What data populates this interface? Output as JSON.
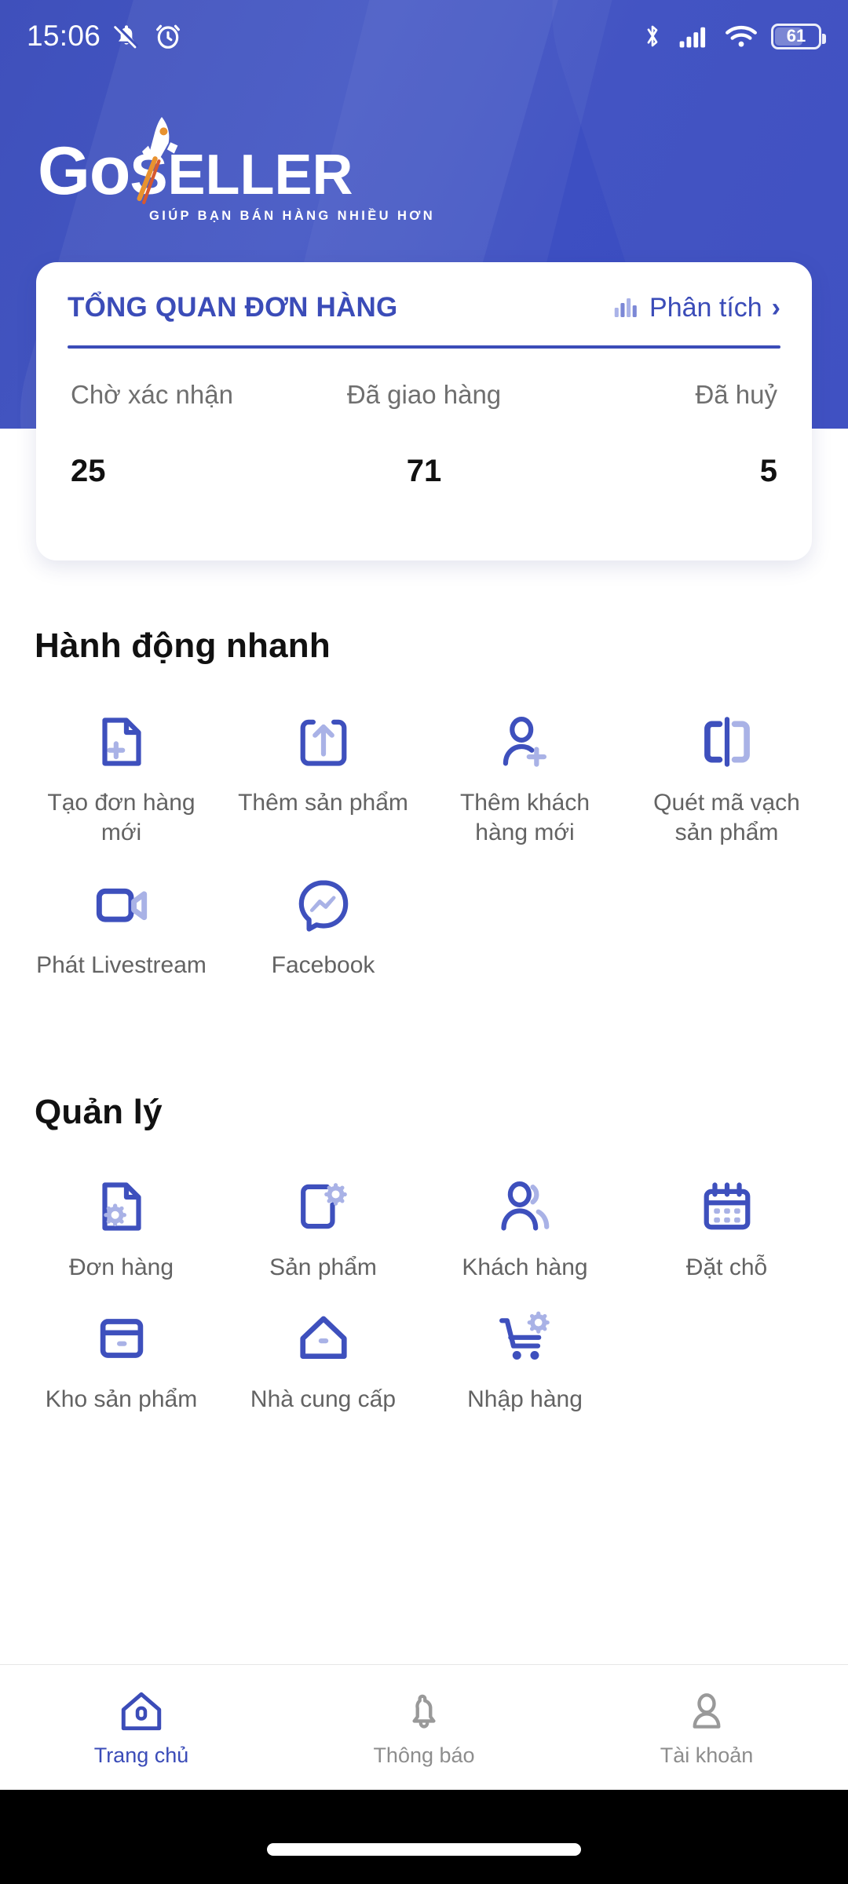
{
  "status_bar": {
    "time": "15:06",
    "icons_left": [
      "bell-muted-icon",
      "alarm-clock-icon"
    ],
    "icons_right": [
      "bluetooth-icon",
      "cellular-signal-icon",
      "wifi-icon"
    ],
    "battery_percent": "61"
  },
  "brand": {
    "logo_go": "Go",
    "logo_seller": "SELLER",
    "tagline": "GIÚP BẠN BÁN HÀNG NHIỀU HƠN",
    "rocket_letter": "G"
  },
  "order_card": {
    "title": "TỔNG QUAN ĐƠN HÀNG",
    "link_label": "Phân tích",
    "link_icon": "bar-chart-icon",
    "chevron": "›",
    "stats": [
      {
        "label": "Chờ xác nhận",
        "value": "25"
      },
      {
        "label": "Đã giao hàng",
        "value": "71"
      },
      {
        "label": "Đã huỷ",
        "value": "5"
      }
    ]
  },
  "quick_actions": {
    "title": "Hành động nhanh",
    "items": [
      {
        "label": "Tạo đơn hàng mới",
        "icon": "document-add-icon"
      },
      {
        "label": "Thêm sản phẩm",
        "icon": "upload-box-icon"
      },
      {
        "label": "Thêm khách hàng mới",
        "icon": "user-add-icon"
      },
      {
        "label": "Quét mã vạch sản phẩm",
        "icon": "barcode-scan-icon"
      },
      {
        "label": "Phát Livestream",
        "icon": "video-camera-icon"
      },
      {
        "label": "Facebook",
        "icon": "messenger-icon"
      }
    ]
  },
  "management": {
    "title": "Quản lý",
    "items": [
      {
        "label": "Đơn hàng",
        "icon": "document-gear-icon"
      },
      {
        "label": "Sản phẩm",
        "icon": "box-gear-icon"
      },
      {
        "label": "Khách hàng",
        "icon": "users-icon"
      },
      {
        "label": "Đặt chỗ",
        "icon": "calendar-icon"
      },
      {
        "label": "Kho sản phẩm",
        "icon": "warehouse-drawer-icon"
      },
      {
        "label": "Nhà cung cấp",
        "icon": "supplier-house-icon"
      },
      {
        "label": "Nhập hàng",
        "icon": "cart-gear-icon"
      }
    ]
  },
  "bottom_nav": {
    "items": [
      {
        "label": "Trang chủ",
        "icon": "home-icon",
        "active": true
      },
      {
        "label": "Thông báo",
        "icon": "bell-icon",
        "active": false
      },
      {
        "label": "Tài khoản",
        "icon": "person-icon",
        "active": false
      }
    ]
  },
  "colors": {
    "header_blue": "#3f50bb",
    "brand_blue": "#3b4cb8",
    "icon_dark": "#3e50bd",
    "icon_light": "#a9b2e6",
    "label_gray": "#636363",
    "inactive_gray": "#8d8d8d"
  }
}
